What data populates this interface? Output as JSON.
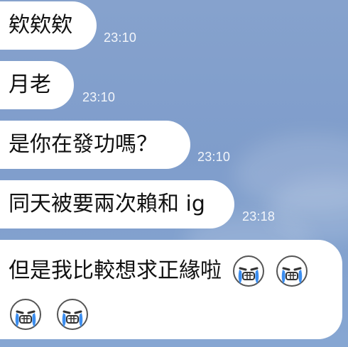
{
  "messages": [
    {
      "text": "欸欸欸",
      "time": "23:10"
    },
    {
      "text": "月老",
      "time": "23:10"
    },
    {
      "text": "是你在發功嗎？",
      "time": "23:10"
    },
    {
      "text": "同天被要兩次賴和 ig",
      "time": "23:18"
    },
    {
      "text": "但是我比較想求正緣啦",
      "emojis_inline": [
        "crying-face-emoji",
        "crying-face-emoji"
      ],
      "emojis_line2": [
        "crying-face-emoji",
        "crying-face-emoji"
      ]
    }
  ],
  "colors": {
    "background": "#7f9dcb",
    "bubble": "#ffffff",
    "timestamp": "#f3f6fb"
  }
}
